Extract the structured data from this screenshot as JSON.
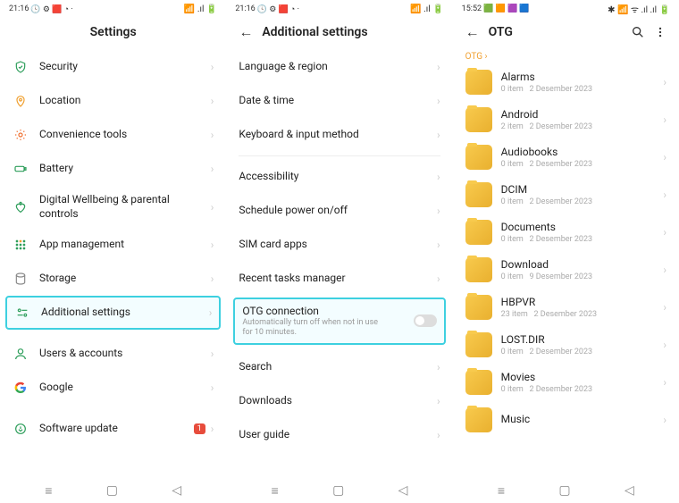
{
  "screen1": {
    "status": {
      "time": "21:16",
      "right": "📶 .ıl 🔋"
    },
    "title": "Settings",
    "items": [
      {
        "icon": "shield",
        "color": "#2e9e5b",
        "label": "Security"
      },
      {
        "icon": "pin",
        "color": "#f0a030",
        "label": "Location"
      },
      {
        "icon": "tools",
        "color": "#f07030",
        "label": "Convenience tools"
      },
      {
        "icon": "battery",
        "color": "#2e9e5b",
        "label": "Battery"
      },
      {
        "icon": "heart",
        "color": "#2e9e5b",
        "label": "Digital Wellbeing & parental controls"
      },
      {
        "icon": "grid",
        "color": "#2e9e5b",
        "label": "App management"
      },
      {
        "icon": "storage",
        "color": "#8a8a8a",
        "label": "Storage"
      },
      {
        "icon": "sliders",
        "color": "#2e9e5b",
        "label": "Additional settings",
        "highlight": true
      }
    ],
    "group2": [
      {
        "icon": "user",
        "color": "#2e9e5b",
        "label": "Users & accounts"
      },
      {
        "icon": "google",
        "color": "#4285F4",
        "label": "Google"
      }
    ],
    "group3": [
      {
        "icon": "update",
        "color": "#2e9e5b",
        "label": "Software update",
        "badge": "1"
      }
    ]
  },
  "screen2": {
    "status": {
      "time": "21:16",
      "right": "📶 .ıl 🔋"
    },
    "title": "Additional settings",
    "group1": [
      "Language & region",
      "Date & time",
      "Keyboard & input method"
    ],
    "group2": [
      "Accessibility",
      "Schedule power on/off",
      "SIM card apps",
      "Recent tasks manager"
    ],
    "otg": {
      "title": "OTG connection",
      "sub": "Automatically turn off when not in use for 10 minutes."
    },
    "group3": [
      "Search",
      "Downloads",
      "User guide"
    ]
  },
  "screen3": {
    "status": {
      "time": "15:52",
      "right": "✱ 📶 ᯤ .ıl .ıl 🔋"
    },
    "title": "OTG",
    "crumb": "OTG ›",
    "folders": [
      {
        "name": "Alarms",
        "items": "0 item",
        "date": "2 Desember 2023"
      },
      {
        "name": "Android",
        "items": "2 item",
        "date": "2 Desember 2023"
      },
      {
        "name": "Audiobooks",
        "items": "0 item",
        "date": "2 Desember 2023"
      },
      {
        "name": "DCIM",
        "items": "0 item",
        "date": "2 Desember 2023"
      },
      {
        "name": "Documents",
        "items": "0 item",
        "date": "2 Desember 2023"
      },
      {
        "name": "Download",
        "items": "0 item",
        "date": "9 Desember 2023"
      },
      {
        "name": "HBPVR",
        "items": "23 item",
        "date": "2 Desember 2023"
      },
      {
        "name": "LOST.DIR",
        "items": "0 item",
        "date": "2 Desember 2023"
      },
      {
        "name": "Movies",
        "items": "0 item",
        "date": "2 Desember 2023"
      },
      {
        "name": "Music",
        "items": "",
        "date": ""
      }
    ]
  }
}
